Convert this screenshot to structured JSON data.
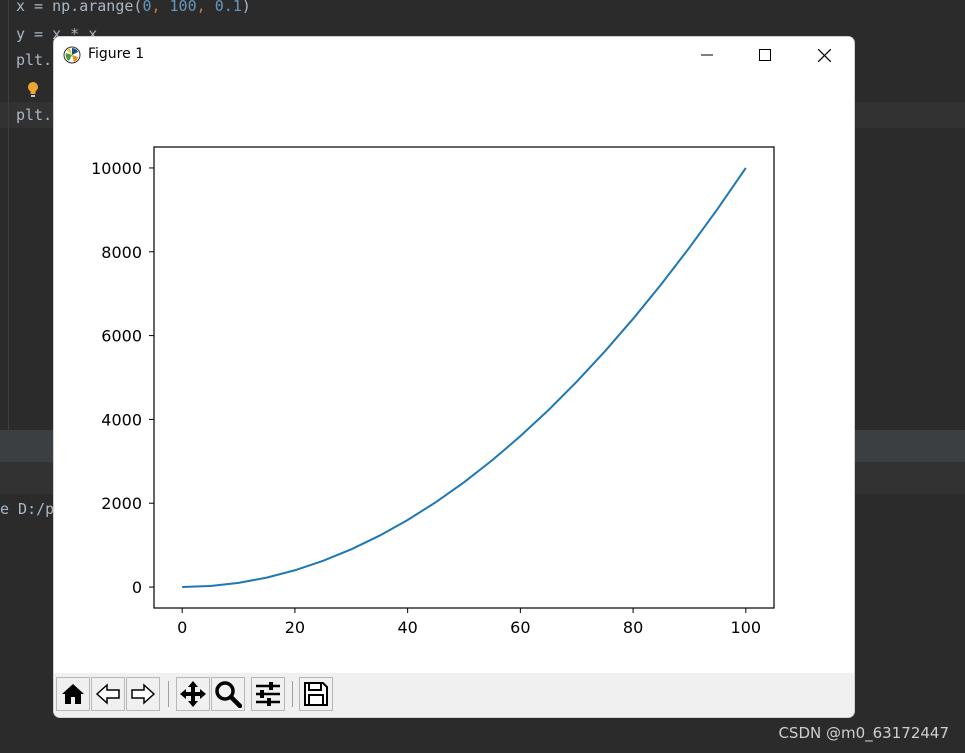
{
  "ide": {
    "code_lines": [
      {
        "a": "x = np.arange(",
        "n1": "0",
        "s1": ", ",
        "n2": "100",
        "s2": ", ",
        "n3": "0.1",
        "b": ")"
      },
      {
        "text": "y = x * x"
      },
      {
        "text": "plt."
      },
      {
        "text": "plt."
      }
    ],
    "console_text": "e D:/p",
    "watermark": "CSDN @m0_63172447"
  },
  "window": {
    "title": "Figure 1",
    "controls": {
      "minimize": "minimize-icon",
      "maximize": "maximize-icon",
      "close": "close-icon"
    }
  },
  "toolbar": {
    "buttons": [
      "home-icon",
      "back-icon",
      "forward-icon",
      "pan-icon",
      "zoom-icon",
      "configure-subplots-icon",
      "save-icon"
    ]
  },
  "chart_data": {
    "type": "line",
    "title": "",
    "xlabel": "",
    "ylabel": "",
    "xlim": [
      -5,
      105
    ],
    "ylim": [
      -500,
      10500
    ],
    "xticks": [
      0,
      20,
      40,
      60,
      80,
      100
    ],
    "yticks": [
      0,
      2000,
      4000,
      6000,
      8000,
      10000
    ],
    "grid": false,
    "series": [
      {
        "color": "#1f77b4",
        "x": [
          0,
          5,
          10,
          15,
          20,
          25,
          30,
          35,
          40,
          45,
          50,
          55,
          60,
          65,
          70,
          75,
          80,
          85,
          90,
          95,
          100
        ],
        "y": [
          0,
          25,
          100,
          225,
          400,
          625,
          900,
          1225,
          1600,
          2025,
          2500,
          3025,
          3600,
          4225,
          4900,
          5625,
          6400,
          7225,
          8100,
          9025,
          10000
        ]
      }
    ]
  }
}
